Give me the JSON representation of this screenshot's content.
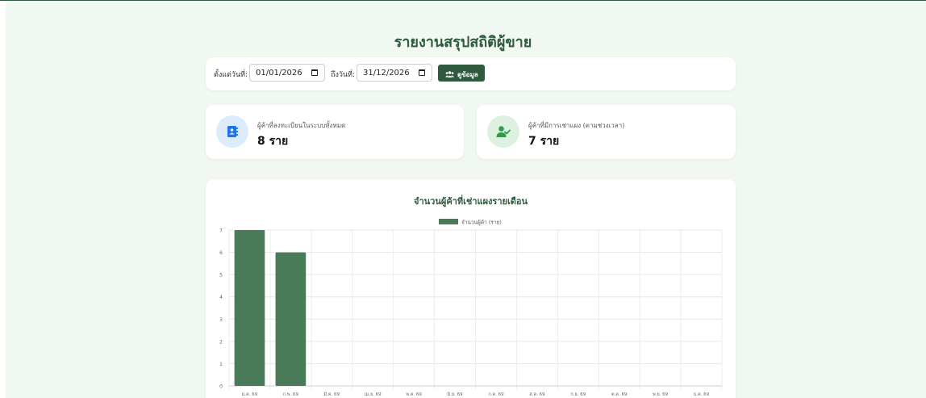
{
  "page": {
    "title": "รายงานสรุปสถิติผู้ขาย"
  },
  "filter": {
    "from_label": "ตั้งแต่วันที่:",
    "from_value": "01/01/2026",
    "to_label": "ถึงวันที่:",
    "to_value": "31/12/2026",
    "view_button_label": "ดูข้อมูล"
  },
  "stats": [
    {
      "label": "ผู้ค้าที่ลงทะเบียนในระบบทั้งหมด",
      "value": "8 ราย",
      "icon": "contact-book-icon",
      "color": "#1a73e8"
    },
    {
      "label": "ผู้ค้าที่มีการเช่าแผง (ตามช่วงเวลา)",
      "value": "7 ราย",
      "icon": "user-check-icon",
      "color": "#2e9d4a"
    }
  ],
  "colors": {
    "accent": "#2f5a3d",
    "bar": "#4a7b58",
    "background": "#f1f8f1"
  },
  "chart_data": {
    "type": "bar",
    "title": "จำนวนผู้ค้าที่เช่าแผงรายเดือน",
    "categories": [
      "ม.ค. 69",
      "ก.พ. 69",
      "มี.ค. 69",
      "เม.ย. 69",
      "พ.ค. 69",
      "มิ.ย. 69",
      "ก.ค. 69",
      "ส.ค. 69",
      "ก.ย. 69",
      "ต.ค. 69",
      "พ.ย. 69",
      "ธ.ค. 69"
    ],
    "series": [
      {
        "name": "จำนวนผู้ค้า (ราย)",
        "values": [
          7,
          6,
          0,
          0,
          0,
          0,
          0,
          0,
          0,
          0,
          0,
          0
        ]
      }
    ],
    "yticks": [
      0,
      1,
      2,
      3,
      4,
      5,
      6,
      7
    ],
    "ylim": [
      0,
      7
    ],
    "grid": true,
    "legend": "top"
  }
}
